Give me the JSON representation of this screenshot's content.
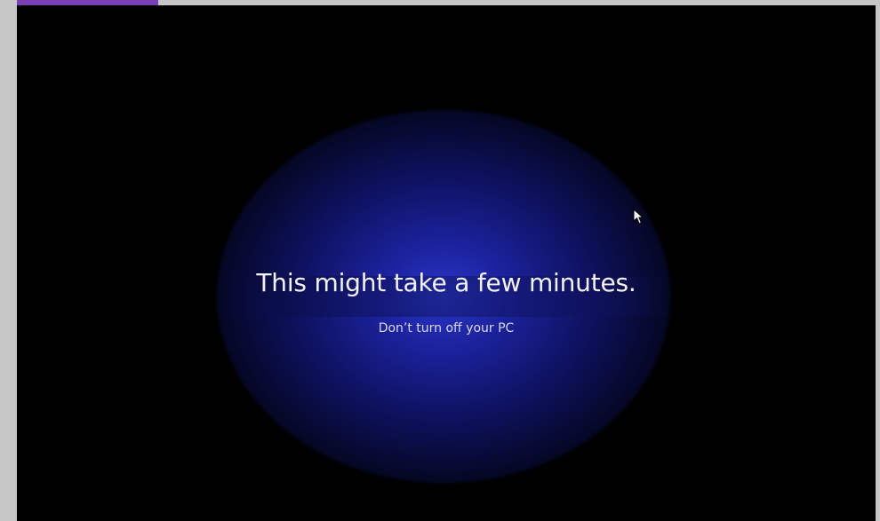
{
  "screen": {
    "title": "This might take a few minutes.",
    "subtitle": "Don’t turn off your PC"
  },
  "icons": {
    "cursor": "arrow-cursor-icon"
  },
  "colors": {
    "page_background": "#c6c6c6",
    "accent_strip": "#7a3fb4",
    "screen_background": "#000000",
    "glow": "#2a38cd",
    "text_primary": "#f2f2f5",
    "text_secondary": "#d8d9e4"
  }
}
